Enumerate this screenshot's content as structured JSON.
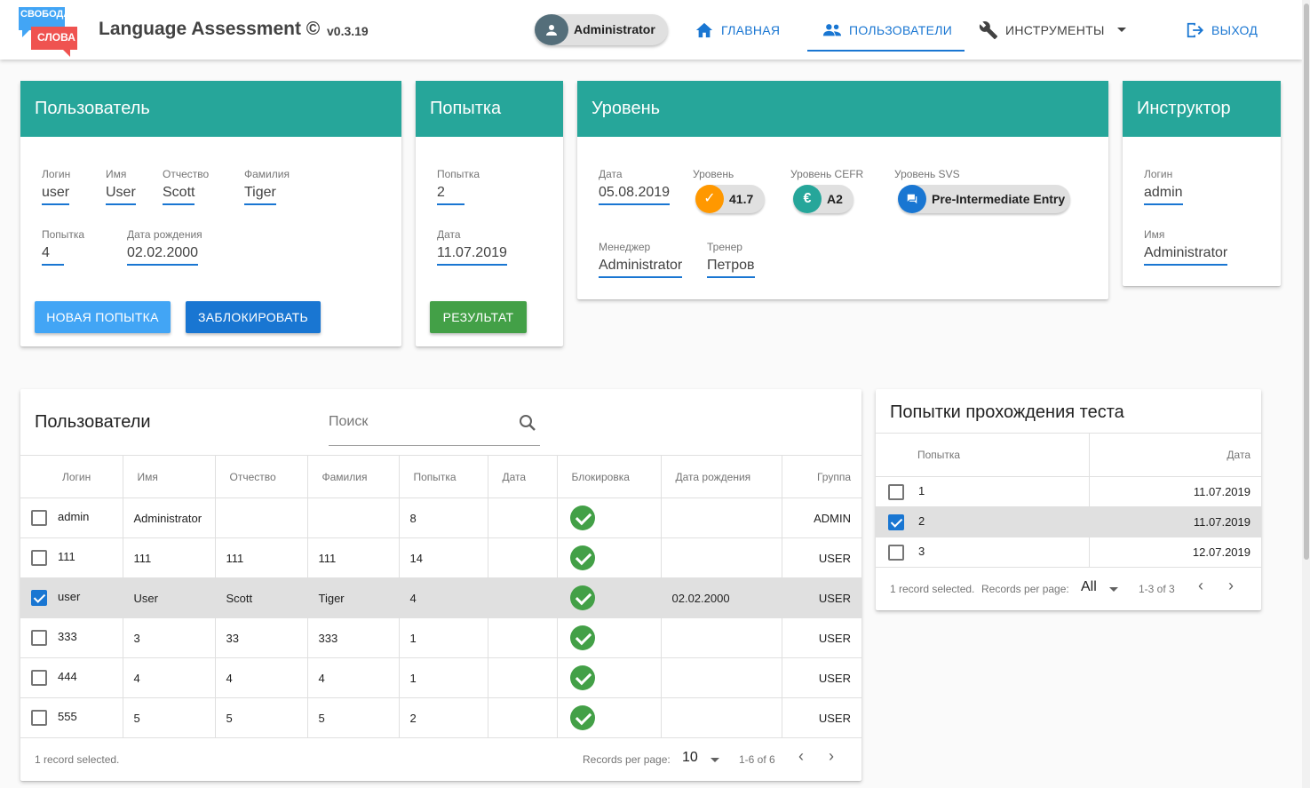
{
  "header": {
    "logo_top": "СВОБОДА",
    "logo_bottom": "СЛОВА",
    "title": "Language Assessment ©",
    "version": "v0.3.19",
    "user_chip": "Administrator",
    "nav": {
      "home": "ГЛАВНАЯ",
      "users": "ПОЛЬЗОВАТЕЛИ",
      "tools": "ИНСТРУМЕНТЫ",
      "logout": "ВЫХОД"
    }
  },
  "user_card": {
    "title": "Пользователь",
    "login_label": "Логин",
    "login": "user",
    "name_label": "Имя",
    "name": "User",
    "patronymic_label": "Отчество",
    "patronymic": "Scott",
    "surname_label": "Фамилия",
    "surname": "Tiger",
    "attempt_label": "Попытка",
    "attempt": "4",
    "birth_label": "Дата рождения",
    "birth": "02.02.2000",
    "btn_new_attempt": "НОВАЯ ПОПЫТКА",
    "btn_block": "ЗАБЛОКИРОВАТЬ"
  },
  "attempt_card": {
    "title": "Попытка",
    "attempt_label": "Попытка",
    "attempt": "2",
    "date_label": "Дата",
    "date": "11.07.2019",
    "btn_result": "РЕЗУЛЬТАТ"
  },
  "level_card": {
    "title": "Уровень",
    "date_label": "Дата",
    "date": "05.08.2019",
    "level_label": "Уровень",
    "level": "41.7",
    "cefr_label": "Уровень CEFR",
    "cefr": "A2",
    "svs_label": "Уровень SVS",
    "svs": "Pre-Intermediate Entry",
    "manager_label": "Менеджер",
    "manager": "Administrator",
    "trainer_label": "Тренер",
    "trainer": "Петров"
  },
  "instructor_card": {
    "title": "Инструктор",
    "login_label": "Логин",
    "login": "admin",
    "name_label": "Имя",
    "name": "Administrator"
  },
  "users_table": {
    "title": "Пользователи",
    "search_placeholder": "Поиск",
    "columns": [
      "Логин",
      "Имя",
      "Отчество",
      "Фамилия",
      "Попытка",
      "Дата",
      "Блокировка",
      "Дата рождения",
      "Группа"
    ],
    "rows": [
      {
        "login": "admin",
        "name": "Administrator",
        "patronymic": "",
        "surname": "",
        "attempt": "8",
        "date": "",
        "blocked": true,
        "birth": "",
        "group": "ADMIN",
        "selected": false
      },
      {
        "login": "111",
        "name": "111",
        "patronymic": "111",
        "surname": "111",
        "attempt": "14",
        "date": "",
        "blocked": true,
        "birth": "",
        "group": "USER",
        "selected": false
      },
      {
        "login": "user",
        "name": "User",
        "patronymic": "Scott",
        "surname": "Tiger",
        "attempt": "4",
        "date": "",
        "blocked": true,
        "birth": "02.02.2000",
        "group": "USER",
        "selected": true
      },
      {
        "login": "333",
        "name": "3",
        "patronymic": "33",
        "surname": "333",
        "attempt": "1",
        "date": "",
        "blocked": true,
        "birth": "",
        "group": "USER",
        "selected": false
      },
      {
        "login": "444",
        "name": "4",
        "patronymic": "4",
        "surname": "4",
        "attempt": "1",
        "date": "",
        "blocked": true,
        "birth": "",
        "group": "USER",
        "selected": false
      },
      {
        "login": "555",
        "name": "5",
        "patronymic": "5",
        "surname": "5",
        "attempt": "2",
        "date": "",
        "blocked": true,
        "birth": "",
        "group": "USER",
        "selected": false
      }
    ],
    "selected_text": "1 record selected.",
    "rpp_label": "Records per page:",
    "rpp_value": "10",
    "range": "1-6 of 6"
  },
  "attempts_table": {
    "title": "Попытки прохождения теста",
    "columns": [
      "Попытка",
      "Дата"
    ],
    "rows": [
      {
        "attempt": "1",
        "date": "11.07.2019",
        "selected": false
      },
      {
        "attempt": "2",
        "date": "11.07.2019",
        "selected": true
      },
      {
        "attempt": "3",
        "date": "12.07.2019",
        "selected": false
      }
    ],
    "selected_text": "1 record selected.",
    "rpp_label": "Records per page:",
    "rpp_value": "All",
    "range": "1-3 of 3"
  },
  "colors": {
    "teal": "#26a69a",
    "primary": "#1976d2",
    "light_blue": "#42a5f5",
    "green": "#43a047",
    "orange": "#ff9800"
  }
}
